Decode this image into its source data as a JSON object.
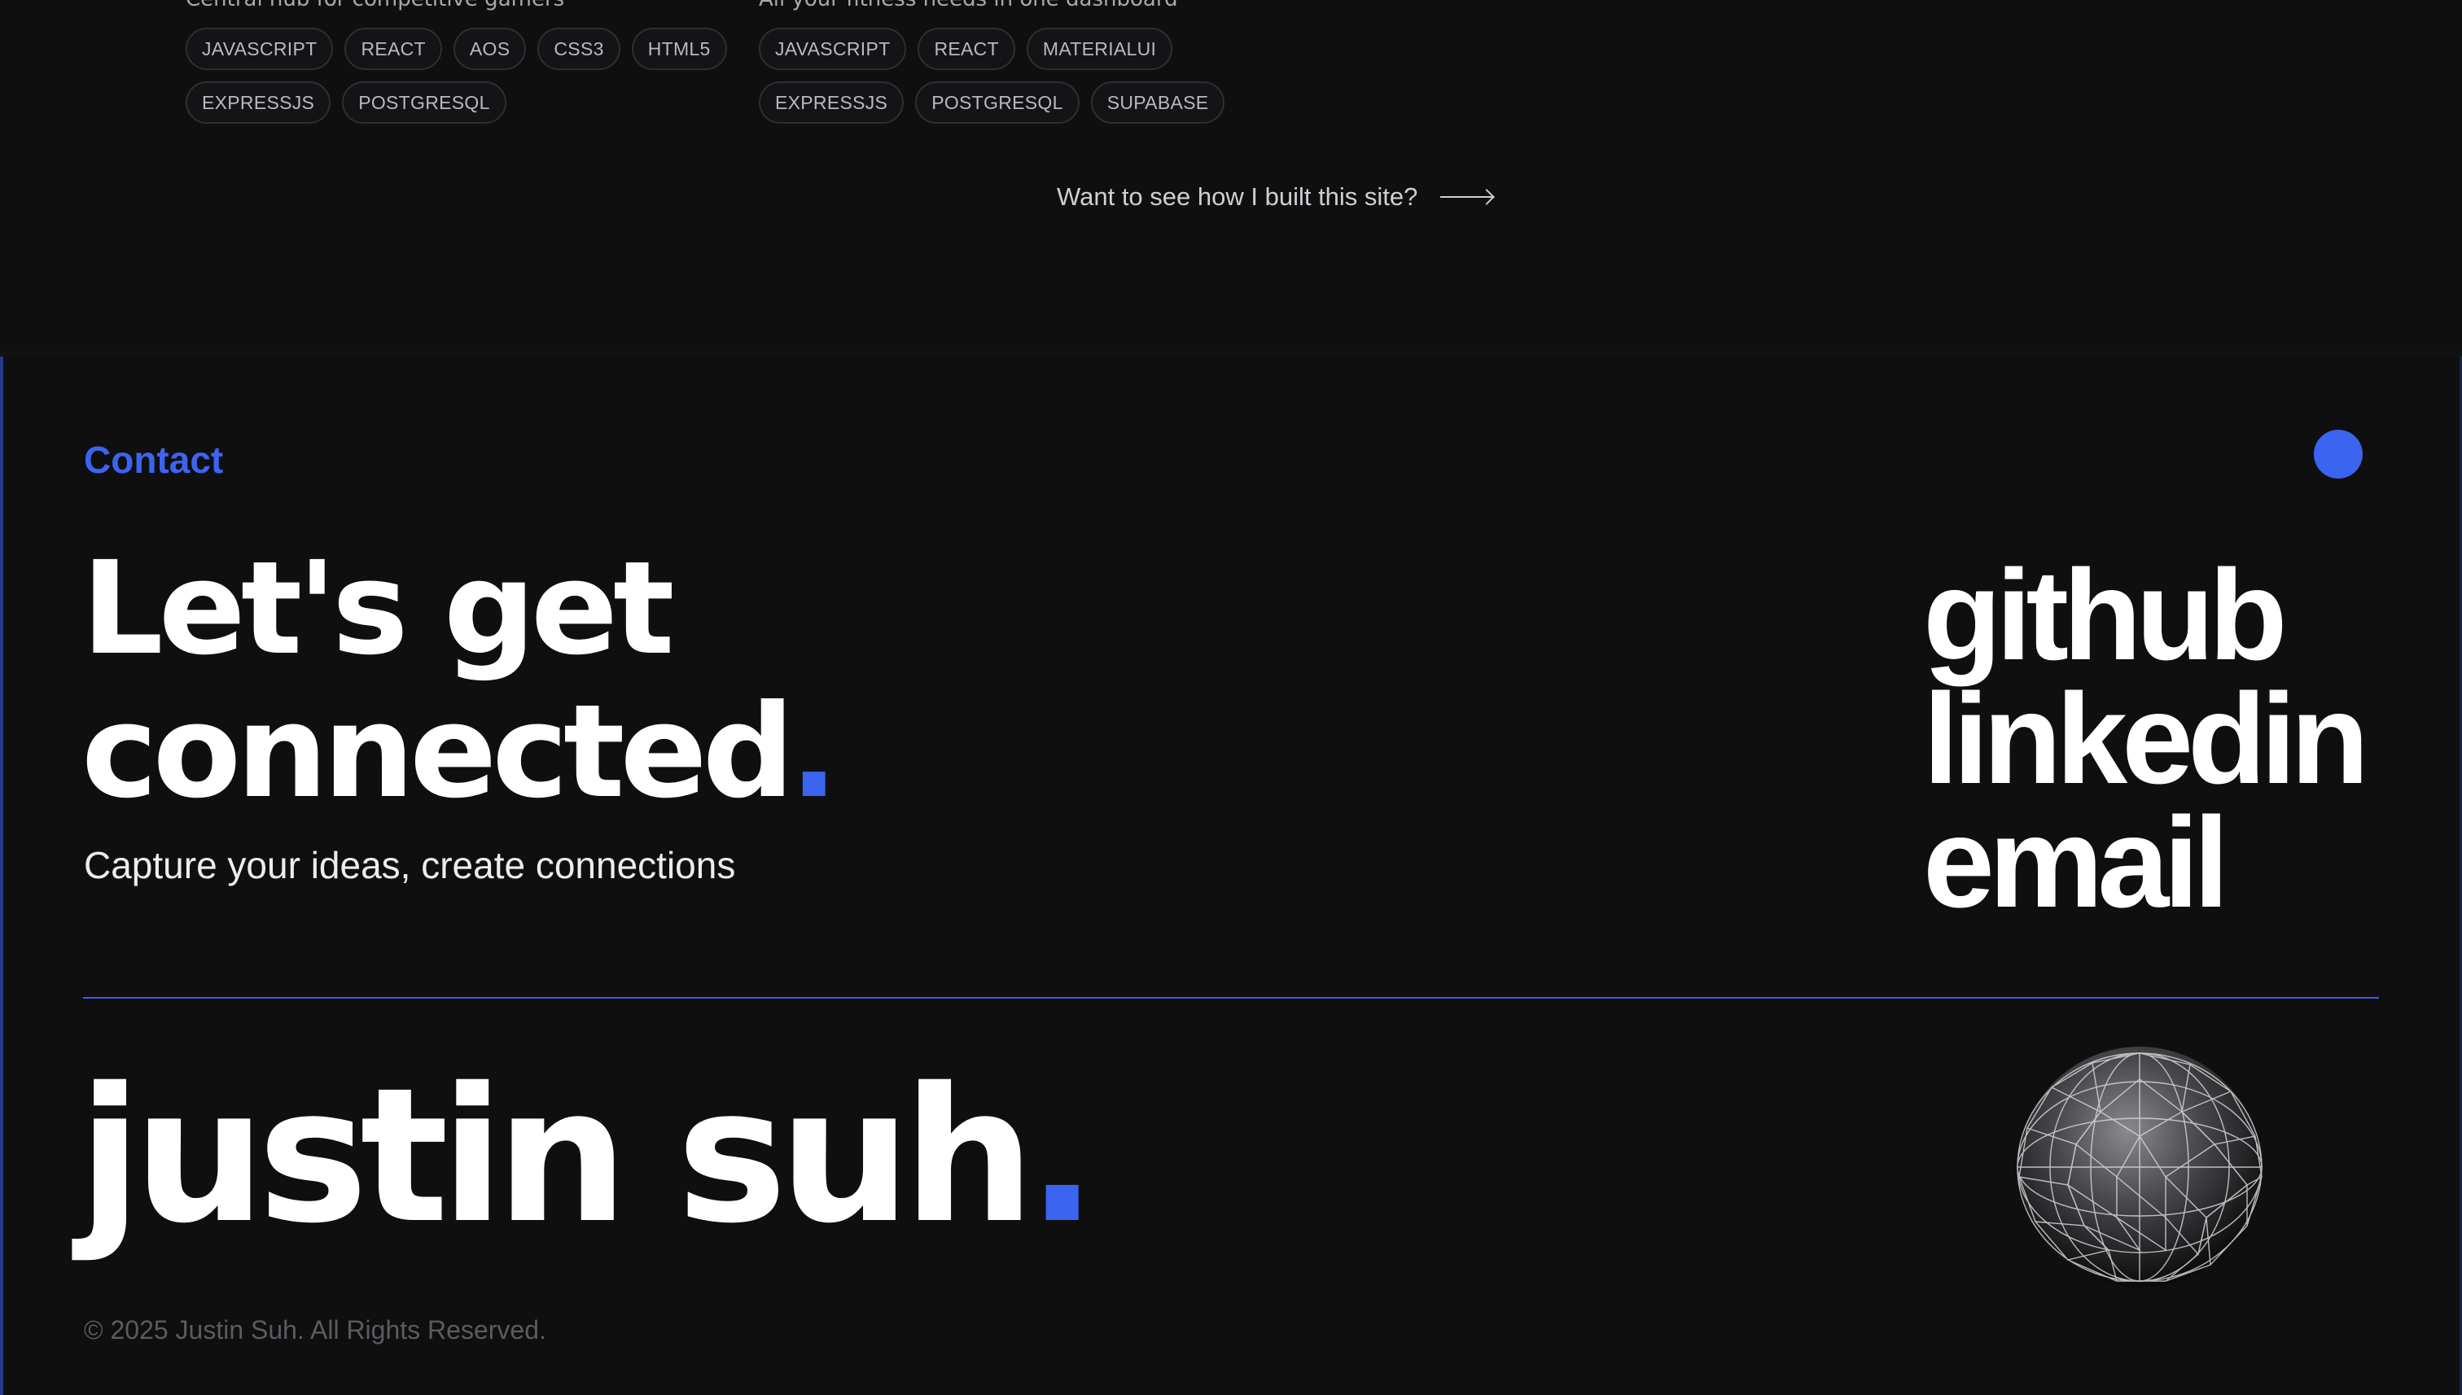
{
  "projects": [
    {
      "description": "Central hub for competitive gamers",
      "tags": [
        "JAVASCRIPT",
        "REACT",
        "AOS",
        "CSS3",
        "HTML5",
        "EXPRESSJS",
        "POSTGRESQL"
      ]
    },
    {
      "description": "All your fitness needs in one dashboard",
      "tags": [
        "JAVASCRIPT",
        "REACT",
        "MATERIALUI",
        "EXPRESSJS",
        "POSTGRESQL",
        "SUPABASE"
      ]
    }
  ],
  "build_link": {
    "label": "Want to see how I built this site?",
    "icon": "arrow-right-icon"
  },
  "contact": {
    "label": "Contact",
    "headline_line1": "Let's get",
    "headline_line2": "connected",
    "period": ".",
    "subline": "Capture your ideas, create connections"
  },
  "links": {
    "github": "github",
    "linkedin": "linkedin",
    "email": "email"
  },
  "footer": {
    "brand": "justin suh",
    "period": ".",
    "copyright": "© 2025 Justin Suh. All Rights Reserved."
  },
  "colors": {
    "background": "#0f0f10",
    "accent": "#3b64f0",
    "text": "#ffffff",
    "muted": "#5b5b61"
  }
}
